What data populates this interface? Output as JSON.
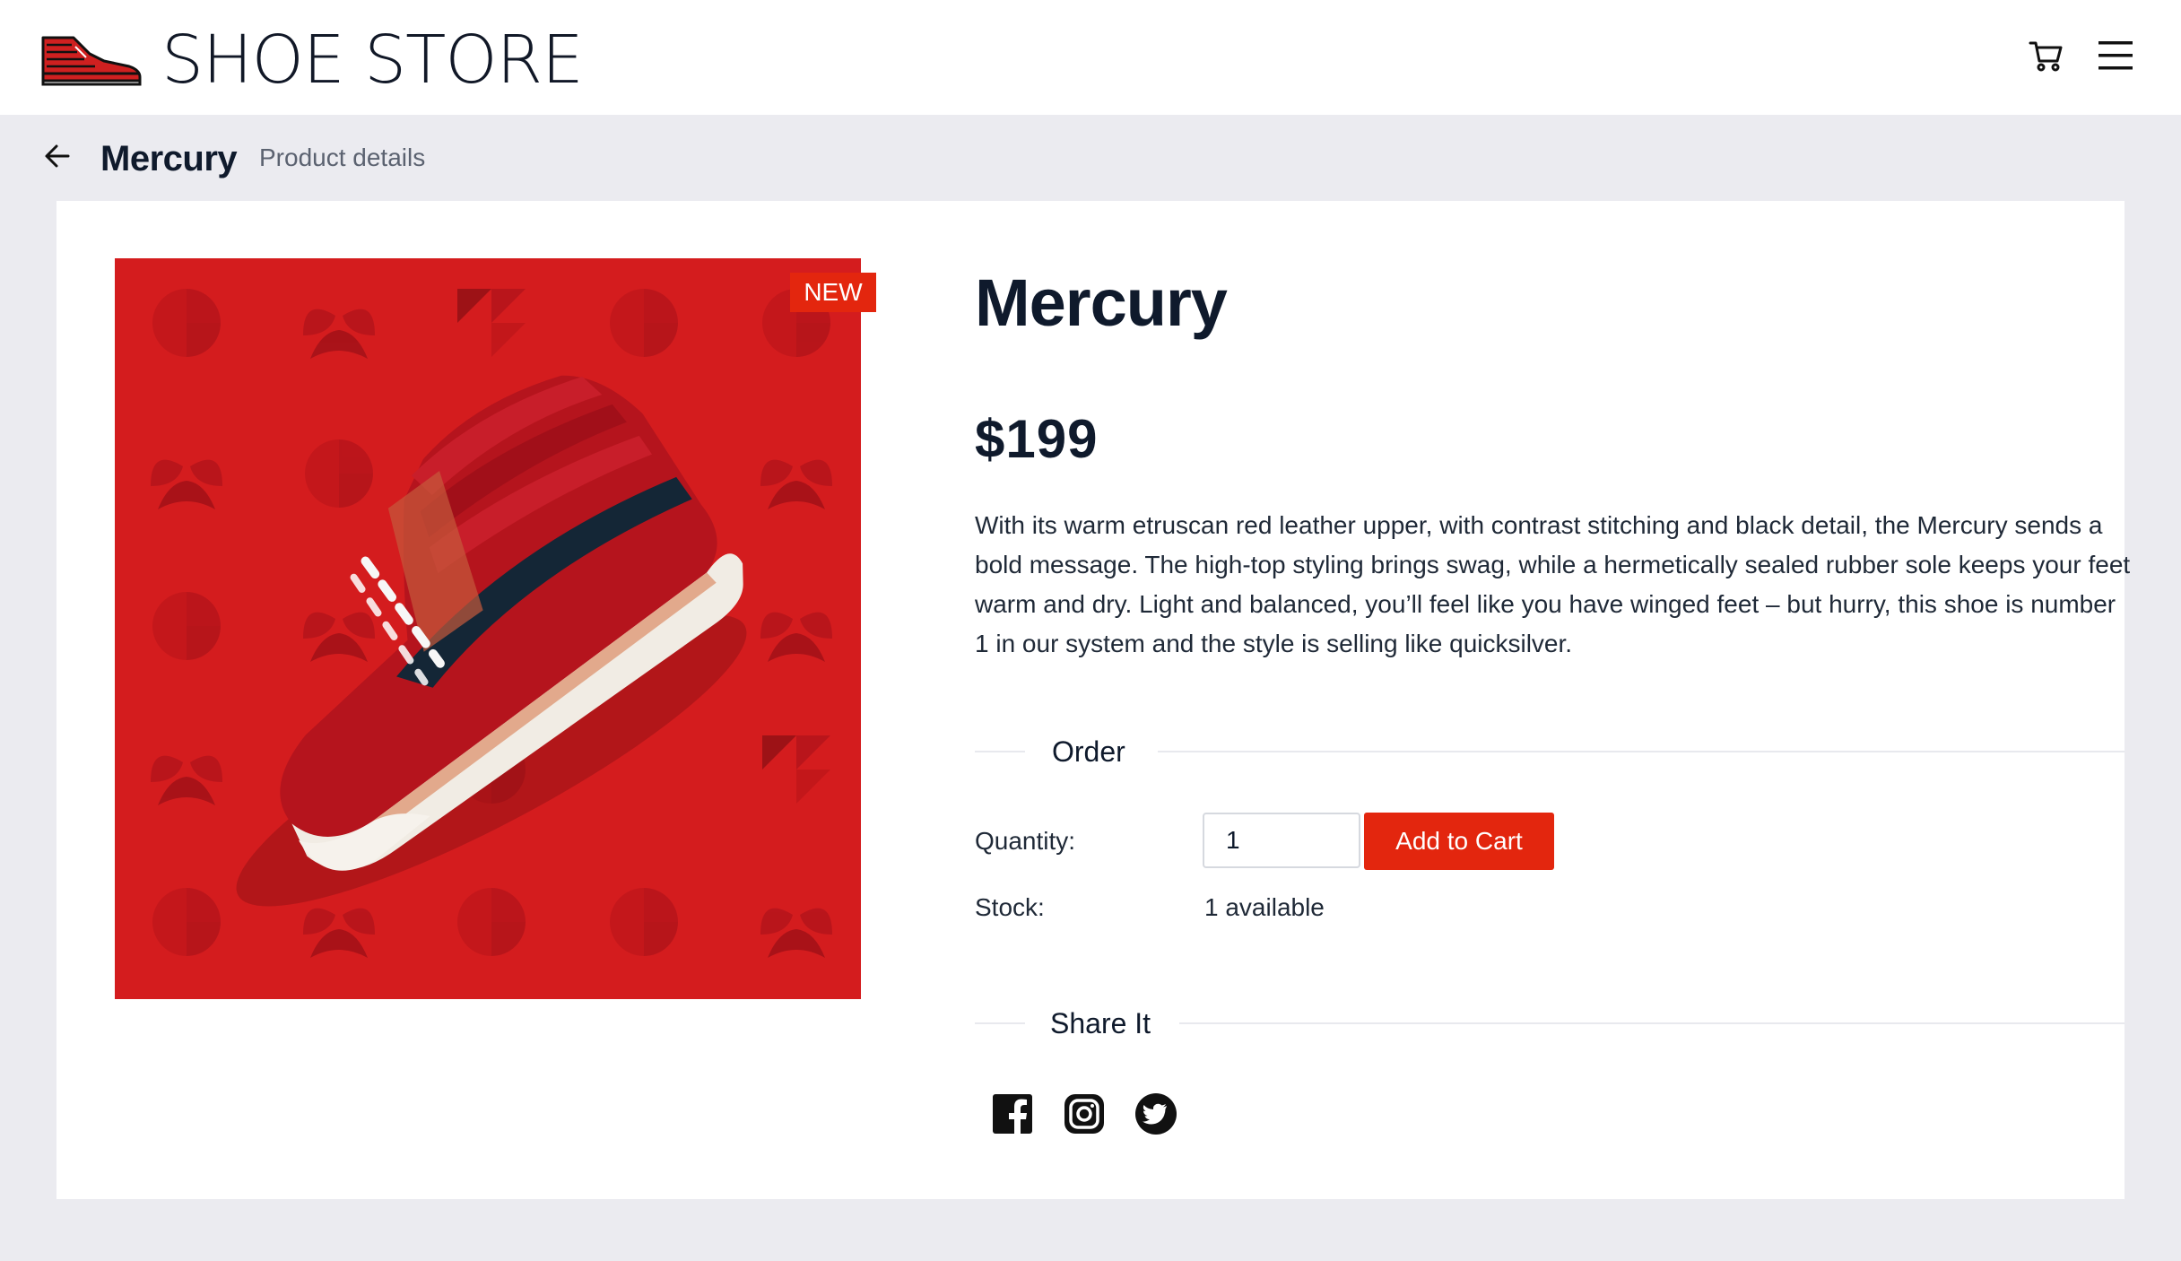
{
  "header": {
    "brand": "SHOE STORE",
    "icons": {
      "logo": "sneaker-logo-icon",
      "cart": "cart-icon",
      "menu": "hamburger-menu-icon"
    }
  },
  "breadcrumb": {
    "back_icon": "arrow-left-icon",
    "title": "Mercury",
    "subtitle": "Product details"
  },
  "product": {
    "badge": "NEW",
    "name": "Mercury",
    "price": "$199",
    "description": "With its warm etruscan red leather upper, with contrast stitching and black detail, the Mercury sends a bold message. The high-top styling brings swag, while a hermetically sealed rubber sole keeps your feet warm and dry. Light and balanced, you’ll feel like you have winged feet – but hurry, this shoe is number 1 in our system and the style is selling like quicksilver.",
    "image": {
      "slides": 2,
      "active_slide": 2
    }
  },
  "order": {
    "heading": "Order",
    "quantity_label": "Quantity:",
    "quantity_value": "1",
    "add_to_cart": "Add to Cart",
    "stock_label": "Stock:",
    "stock_value": "1 available"
  },
  "share": {
    "heading": "Share It",
    "icons": [
      "facebook-icon",
      "instagram-icon",
      "twitter-icon"
    ]
  },
  "colors": {
    "accent": "#e3260e",
    "image_background": "#d41c1e",
    "page_background": "#ebebf0",
    "text_dark": "#0f1a2c"
  }
}
